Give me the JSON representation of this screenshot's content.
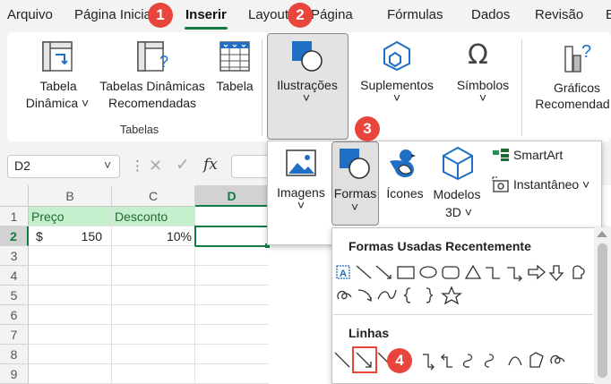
{
  "menubar": {
    "items": [
      {
        "label": "Arquivo"
      },
      {
        "label": "Página Inicial"
      },
      {
        "label": "Inserir"
      },
      {
        "label": "Layout da Página"
      },
      {
        "label": "Fórmulas"
      },
      {
        "label": "Dados"
      },
      {
        "label": "Revisão"
      },
      {
        "label": "E"
      }
    ],
    "active": "Inserir"
  },
  "ribbon": {
    "tabela_dinamica": {
      "line1": "Tabela",
      "line2": "Dinâmica ˅"
    },
    "tabelas_recomendadas": {
      "line1": "Tabelas Dinâmicas",
      "line2": "Recomendadas"
    },
    "tabela": {
      "label": "Tabela"
    },
    "group_tabelas": "Tabelas",
    "ilustracoes": {
      "label": "Ilustrações",
      "chevron": "˅"
    },
    "suplementos": {
      "label": "Suplementos",
      "chevron": "˅"
    },
    "simbolos": {
      "label": "Símbolos",
      "chevron": "˅"
    },
    "graficos": {
      "line1": "Gráficos",
      "line2": "Recomendad"
    }
  },
  "formula_bar": {
    "name_box": "D2",
    "fx": "fx"
  },
  "sheet": {
    "columns": [
      "B",
      "C",
      "D"
    ],
    "selected_column": "D",
    "rows": [
      "1",
      "2",
      "3",
      "4",
      "5",
      "6",
      "7",
      "8",
      "9"
    ],
    "selected_row": "2",
    "cells": {
      "B1": "Preço",
      "C1": "Desconto",
      "B2_currency": "$",
      "B2_value": "150",
      "C2": "10%"
    }
  },
  "illustrations_panel": {
    "imagens": {
      "label": "Imagens",
      "chevron": "˅"
    },
    "formas": {
      "label": "Formas",
      "chevron": "˅"
    },
    "icones": {
      "label": "Ícones"
    },
    "modelos3d": {
      "line1": "Modelos",
      "line2": "3D ˅"
    },
    "smartart": {
      "label": "SmartArt"
    },
    "instantaneo": {
      "label": "Instantâneo ˅"
    }
  },
  "shapes_panel": {
    "recent_title": "Formas Usadas Recentemente",
    "lines_title": "Linhas"
  },
  "callouts": [
    "1",
    "2",
    "3",
    "4"
  ],
  "colors": {
    "accent_green": "#107c41",
    "callout_red": "#e8453c",
    "header_fill": "#c6efce",
    "icon_blue": "#1f6fc5"
  }
}
